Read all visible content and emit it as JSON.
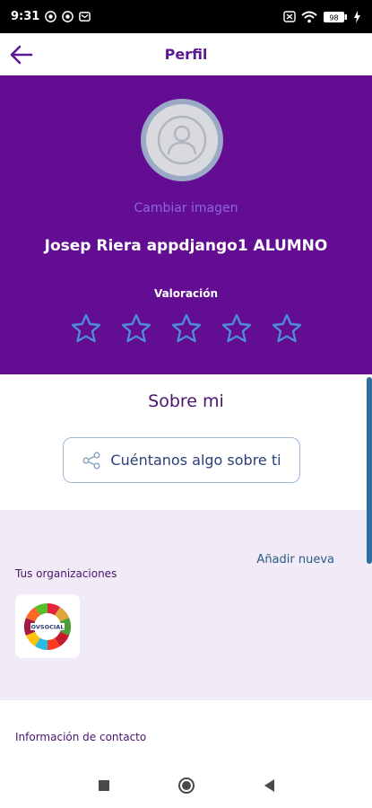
{
  "status_bar": {
    "time": "9:31",
    "battery": "98"
  },
  "app_bar": {
    "title": "Perfil"
  },
  "profile": {
    "change_image": "Cambiar imagen",
    "name": "Josep Riera appdjango1 ALUMNO",
    "rating_label": "Valoración",
    "rating": 0,
    "rating_max": 5
  },
  "about": {
    "title": "Sobre mi",
    "button_label": "Cuéntanos algo sobre ti"
  },
  "organizations": {
    "add_new": "Añadir nueva",
    "title": "Tus organizaciones",
    "logo_text": "OVSOCIAL"
  },
  "contact": {
    "title": "Información de contacto"
  },
  "colors": {
    "primary_purple": "#620d92",
    "title_purple": "#5b1a94",
    "star_blue": "#4f8bd6",
    "section_bg": "#f1ebf8"
  }
}
